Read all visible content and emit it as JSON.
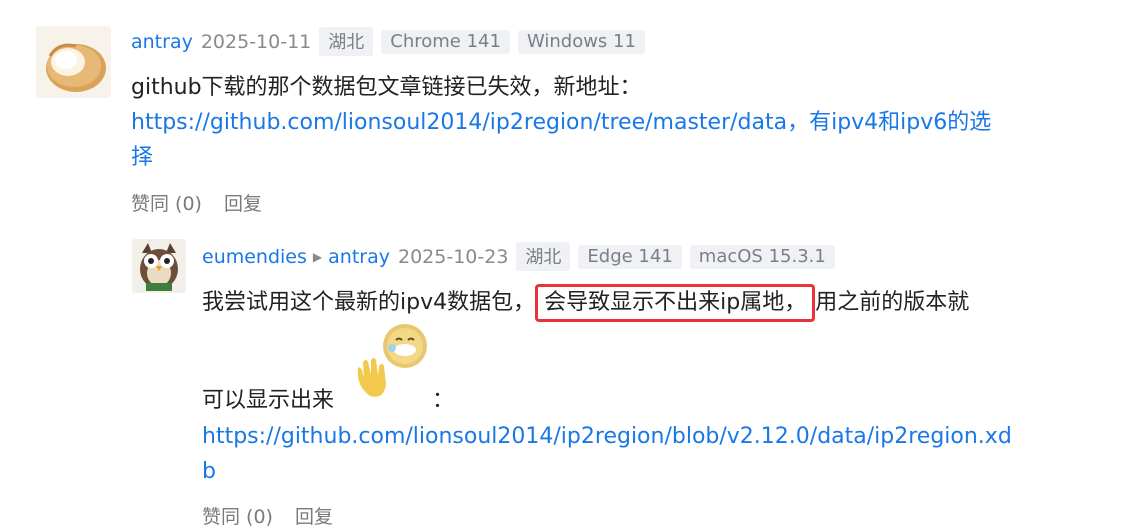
{
  "comment1": {
    "username": "antray",
    "date": "2025-10-11",
    "tags": [
      "湖北",
      "Chrome 141",
      "Windows 11"
    ],
    "text": "github下载的那个数据包文章链接已失效，新地址：",
    "link_line1": "https://github.com/lionsoul2014/ip2region/tree/master/data，有ipv4和ipv6的选",
    "link_line2": "择",
    "like_label": "赞同 (0)",
    "reply_label": "回复"
  },
  "reply1": {
    "username": "eumendies",
    "reply_to": "antray",
    "date": "2025-10-23",
    "tags": [
      "湖北",
      "Edge 141",
      "macOS 15.3.1"
    ],
    "text_before": "我尝试用这个最新的ipv4数据包",
    "text_highlight": "会导致显示不出来ip属地",
    "text_after": "用之前的版本就",
    "text_line2": "可以显示出来",
    "colon": "：",
    "link_line1": "https://github.com/lionsoul2014/ip2region/blob/v2.12.0/data/ip2region.xd",
    "link_line2": "b",
    "like_label": "赞同 (0)",
    "reply_label": "回复"
  },
  "colors": {
    "link": "#1a78e6",
    "highlight_border": "#e8333a",
    "tag_bg": "#f0f1f4"
  },
  "icons": {
    "reply_arrow": "caret-right-icon",
    "emoji": "waving-face-emoji"
  }
}
